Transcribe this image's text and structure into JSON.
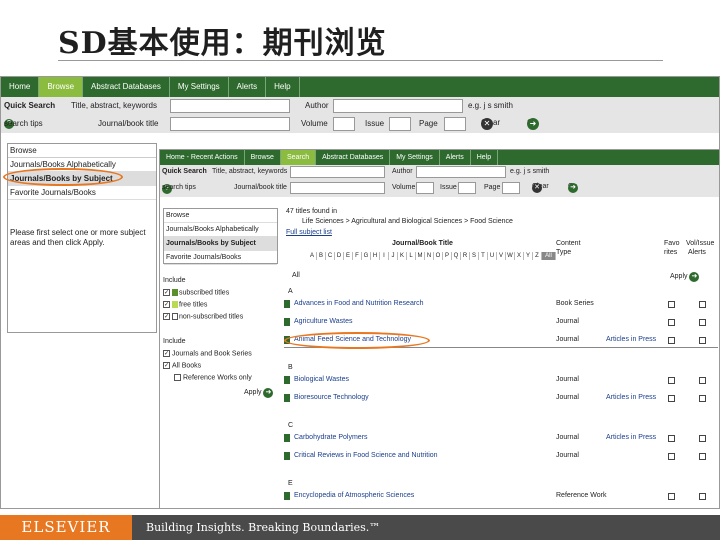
{
  "slide": {
    "title": "SD基本使用：期刊浏览"
  },
  "nav": {
    "tabs": [
      "Home",
      "Browse",
      "Abstract Databases",
      "My Settings",
      "Alerts",
      "Help"
    ]
  },
  "quick_search": {
    "label": "Quick Search",
    "title_label": "Title, abstract, keywords",
    "author_label": "Author",
    "author_hint": "e.g. j s smith",
    "tips": "search tips",
    "journal_label": "Journal/book title",
    "volume_label": "Volume",
    "issue_label": "Issue",
    "page_label": "Page",
    "clear": "Clear",
    "go": "Go"
  },
  "browse_panel": {
    "header": "Browse",
    "items": [
      "Journals/Books Alphabetically",
      "Journals/Books by Subject",
      "Favorite Journals/Books"
    ],
    "message": "Please first select one or more subject areas and then click Apply."
  },
  "inner": {
    "nav_tabs": [
      "Home - Recent Actions",
      "Browse",
      "Search",
      "Abstract Databases",
      "My Settings",
      "Alerts",
      "Help"
    ],
    "qs_label": "Quick Search",
    "title_label": "Title, abstract, keywords",
    "author_label": "Author",
    "author_hint": "e.g. j s smith",
    "tips": "search tips",
    "journal_label": "Journal/book title",
    "volume_label": "Volume",
    "issue_label": "Issue",
    "page_label": "Page",
    "clear": "Clear",
    "go": "Go",
    "browse_header": "Browse",
    "browse_items": [
      "Journals/Books Alphabetically",
      "Journals/Books by Subject",
      "Favorite Journals/Books"
    ],
    "include_label": "Include",
    "include_options": [
      "subscribed titles",
      "free titles",
      "non-subscribed titles"
    ],
    "include2_label": "Include",
    "include2_options": [
      "Journals and Book Series",
      "All Books",
      "Reference Works only"
    ],
    "apply": "Apply",
    "results_count": "47 titles found in",
    "breadcrumb": "Life Sciences > Agricultural and Biological Sciences > Food Science",
    "full_list": "Full subject list",
    "col_title": "Journal/Book Title",
    "col_content": "Content",
    "col_type": "Type",
    "col_fav": "Favo",
    "col_fav2": "rites",
    "col_vol": "Vol/Issue",
    "col_vol2": "Alerts",
    "letters": [
      "A",
      "B",
      "C",
      "D",
      "E",
      "F",
      "G",
      "H",
      "I",
      "J",
      "K",
      "L",
      "M",
      "N",
      "O",
      "P",
      "Q",
      "R",
      "S",
      "T",
      "U",
      "V",
      "W",
      "X",
      "Y",
      "Z",
      "All"
    ],
    "all_label": "All",
    "group_a": "A",
    "group_b": "B",
    "group_c": "C",
    "group_e": "E",
    "rows": [
      {
        "title": "Advances in Food and Nutrition Research",
        "type": "Book Series",
        "press": ""
      },
      {
        "title": "Agriculture Wastes",
        "type": "Journal",
        "press": ""
      },
      {
        "title": "Animal Feed Science and Technology",
        "type": "Journal",
        "press": "Articles in Press"
      },
      {
        "title": "Biological Wastes",
        "type": "Journal",
        "press": ""
      },
      {
        "title": "Bioresource Technology",
        "type": "Journal",
        "press": "Articles in Press"
      },
      {
        "title": "Carbohydrate Polymers",
        "type": "Journal",
        "press": "Articles in Press"
      },
      {
        "title": "Critical Reviews in Food Science and Nutrition",
        "type": "Journal",
        "press": ""
      },
      {
        "title": "Encyclopedia of Atmospheric Sciences",
        "type": "Reference Work",
        "press": ""
      }
    ]
  },
  "footer": {
    "logo": "ELSEVIER",
    "tagline": "Building Insights. Breaking Boundaries.™"
  },
  "colors": {
    "nav_green": "#2e6a2e",
    "active_tab": "#8cbc3f",
    "highlight_oval": "#e87722"
  }
}
